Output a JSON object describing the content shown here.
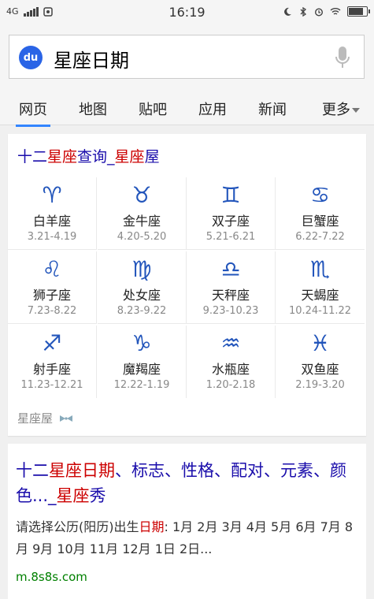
{
  "statusbar": {
    "network": "4G",
    "time": "16:19"
  },
  "search": {
    "logo_text": "du",
    "query": "星座日期"
  },
  "tabs": [
    {
      "label": "网页",
      "active": true
    },
    {
      "label": "地图",
      "active": false
    },
    {
      "label": "贴吧",
      "active": false
    },
    {
      "label": "应用",
      "active": false
    },
    {
      "label": "新闻",
      "active": false
    }
  ],
  "more_tab": "更多",
  "zodiac_card": {
    "title_prefix": "十二",
    "title_highlight": "星座",
    "title_middle": "查询_",
    "title_highlight2": "星座",
    "title_suffix": "屋",
    "signs": [
      {
        "name": "白羊座",
        "dates": "3.21-4.19",
        "icon": "aries-icon",
        "glyph": "♈"
      },
      {
        "name": "金牛座",
        "dates": "4.20-5.20",
        "icon": "taurus-icon",
        "glyph": "♉"
      },
      {
        "name": "双子座",
        "dates": "5.21-6.21",
        "icon": "gemini-icon",
        "glyph": "♊"
      },
      {
        "name": "巨蟹座",
        "dates": "6.22-7.22",
        "icon": "cancer-icon",
        "glyph": "♋"
      },
      {
        "name": "狮子座",
        "dates": "7.23-8.22",
        "icon": "leo-icon",
        "glyph": "♌"
      },
      {
        "name": "处女座",
        "dates": "8.23-9.22",
        "icon": "virgo-icon",
        "glyph": "♍"
      },
      {
        "name": "天秤座",
        "dates": "9.23-10.23",
        "icon": "libra-icon",
        "glyph": "♎"
      },
      {
        "name": "天蝎座",
        "dates": "10.24-11.22",
        "icon": "scorpio-icon",
        "glyph": "♏"
      },
      {
        "name": "射手座",
        "dates": "11.23-12.21",
        "icon": "sagittarius-icon",
        "glyph": "♐"
      },
      {
        "name": "魔羯座",
        "dates": "12.22-1.19",
        "icon": "capricorn-icon",
        "glyph": "♑"
      },
      {
        "name": "水瓶座",
        "dates": "1.20-2.18",
        "icon": "aquarius-icon",
        "glyph": "♒"
      },
      {
        "name": "双鱼座",
        "dates": "2.19-3.20",
        "icon": "pisces-icon",
        "glyph": "♓"
      }
    ],
    "source": "星座屋"
  },
  "result2": {
    "title_a": "十二",
    "title_b": "星座日期",
    "title_c": "、标志、性格、配对、元素、颜色..._",
    "title_d": "星座",
    "title_e": "秀",
    "desc_a": "请选择公历(阳历)出生",
    "desc_b": "日期",
    "desc_c": ": 1月 2月 3月 4月 5月 6月 7月 8月 9月 10月 11月 12月 1日 2日...",
    "url": "m.8s8s.com"
  },
  "colors": {
    "link": "#1a0dab",
    "highlight": "#cc0000",
    "zodiac": "#2255bb",
    "url": "#008000"
  }
}
